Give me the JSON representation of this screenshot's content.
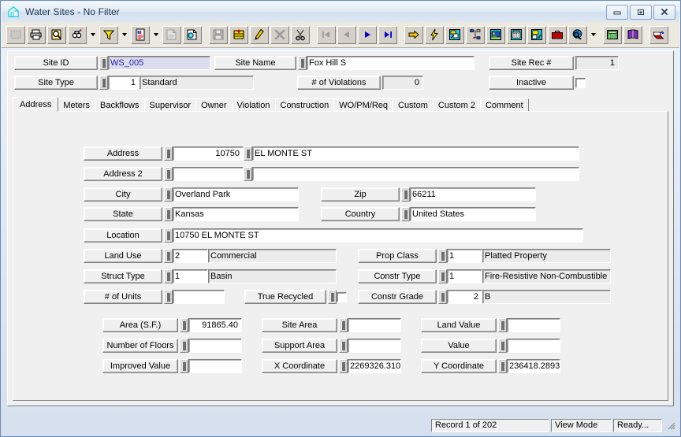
{
  "window": {
    "title": "Water Sites - No Filter",
    "icon": "water-tank-icon",
    "minimize_label": "Minimize",
    "restore_label": "Restore",
    "close_label": "Close"
  },
  "toolbar": {
    "groups": [
      {
        "buttons": [
          {
            "name": "select-all-icon",
            "label": "Select All",
            "disabled": true
          },
          {
            "name": "print-icon",
            "label": "Print"
          },
          {
            "name": "print-preview-icon",
            "label": "Print Preview"
          },
          {
            "name": "find-icon",
            "label": "Find",
            "dropdown": true
          },
          {
            "name": "filter-icon",
            "label": "Filter",
            "dropdown": true
          },
          {
            "name": "report-icon",
            "label": "Reports",
            "dropdown": true
          },
          {
            "name": "copy-record-icon",
            "label": "Copy Record",
            "disabled": true
          },
          {
            "name": "duplicate-icon",
            "label": "Duplicate"
          }
        ]
      },
      {
        "buttons": [
          {
            "name": "save-icon",
            "label": "Save",
            "disabled": true
          },
          {
            "name": "post-icon",
            "label": "Post"
          },
          {
            "name": "edit-pencil-icon",
            "label": "Edit"
          },
          {
            "name": "delete-x-icon",
            "label": "Delete",
            "disabled": true
          },
          {
            "name": "cut-scissors-icon",
            "label": "Cut"
          }
        ]
      },
      {
        "buttons": [
          {
            "name": "first-record-icon",
            "label": "First Record",
            "disabled": true
          },
          {
            "name": "previous-record-icon",
            "label": "Previous Record",
            "disabled": true
          },
          {
            "name": "next-record-icon",
            "label": "Next Record"
          },
          {
            "name": "last-record-icon",
            "label": "Last Record"
          }
        ]
      },
      {
        "buttons": [
          {
            "name": "goto-arrow-icon",
            "label": "Go To"
          },
          {
            "name": "lightning-icon",
            "label": "Quick Action"
          },
          {
            "name": "map-icon",
            "label": "Map"
          },
          {
            "name": "hierarchy-icon",
            "label": "Hierarchy"
          },
          {
            "name": "image-icon",
            "label": "Images"
          },
          {
            "name": "fax-icon",
            "label": "Fax"
          },
          {
            "name": "attachment-image-icon",
            "label": "Attachments"
          },
          {
            "name": "toolbox-icon",
            "label": "Tools"
          },
          {
            "name": "globe-search-icon",
            "label": "Web Lookup",
            "dropdown": true
          }
        ]
      },
      {
        "buttons": [
          {
            "name": "calculator-icon",
            "label": "Calculator"
          },
          {
            "name": "book-icon",
            "label": "Help Book"
          }
        ]
      },
      {
        "buttons": [
          {
            "name": "exit-icon",
            "label": "Exit"
          }
        ]
      }
    ]
  },
  "header": {
    "site_id": {
      "label": "Site ID",
      "value": "WS_005",
      "selected": true
    },
    "site_name": {
      "label": "Site Name",
      "value": "Fox Hill S"
    },
    "site_rec": {
      "label": "Site Rec #",
      "value": "1"
    },
    "site_type": {
      "label": "Site Type",
      "code": "1",
      "desc": "Standard"
    },
    "violations": {
      "label": "# of Violations",
      "value": "0"
    },
    "inactive": {
      "label": "Inactive",
      "checked": false
    }
  },
  "tabs": [
    {
      "label": "Address",
      "active": true
    },
    {
      "label": "Meters",
      "active": false
    },
    {
      "label": "Backflows",
      "active": false
    },
    {
      "label": "Supervisor",
      "active": false
    },
    {
      "label": "Owner",
      "active": false
    },
    {
      "label": "Violation",
      "active": false
    },
    {
      "label": "Construction",
      "active": false
    },
    {
      "label": "WO/PM/Req",
      "active": false
    },
    {
      "label": "Custom",
      "active": false
    },
    {
      "label": "Custom 2",
      "active": false
    },
    {
      "label": "Comment",
      "active": false
    }
  ],
  "address_tab": {
    "address": {
      "label": "Address",
      "number": "10750",
      "street": "EL MONTE ST"
    },
    "address2": {
      "label": "Address 2",
      "number": "",
      "street": ""
    },
    "city": {
      "label": "City",
      "value": "Overland Park"
    },
    "zip": {
      "label": "Zip",
      "value": "66211"
    },
    "state": {
      "label": "State",
      "value": "Kansas"
    },
    "country": {
      "label": "Country",
      "value": "United States"
    },
    "location": {
      "label": "Location",
      "value": "10750 EL MONTE ST"
    },
    "land_use": {
      "label": "Land Use",
      "code": "2",
      "desc": "Commercial"
    },
    "prop_class": {
      "label": "Prop Class",
      "code": "1",
      "desc": "Platted Property"
    },
    "struct_type": {
      "label": "Struct Type",
      "code": "1",
      "desc": "Basin"
    },
    "constr_type": {
      "label": "Constr Type",
      "code": "1",
      "desc": "Fire-Resistive Non-Combustible"
    },
    "units": {
      "label": "# of Units",
      "value": ""
    },
    "true_recycled": {
      "label": "True Recycled",
      "checked": false
    },
    "constr_grade": {
      "label": "Constr Grade",
      "code": "2",
      "desc": "B"
    },
    "area_sf": {
      "label": "Area (S.F.)",
      "value": "91865.40"
    },
    "site_area": {
      "label": "Site Area",
      "value": ""
    },
    "land_value": {
      "label": "Land Value",
      "value": ""
    },
    "floors": {
      "label": "Number of Floors",
      "value": ""
    },
    "support_area": {
      "label": "Support Area",
      "value": ""
    },
    "value": {
      "label": "Value",
      "value": ""
    },
    "improved_value": {
      "label": "Improved Value",
      "value": ""
    },
    "x_coordinate": {
      "label": "X Coordinate",
      "value": "2269326.3100"
    },
    "y_coordinate": {
      "label": "Y Coordinate",
      "value": "236418.2893"
    }
  },
  "statusbar": {
    "record": "Record 1 of 202",
    "mode": "View Mode",
    "state": "Ready...",
    "grip": "resize-grip-icon"
  },
  "colors": {
    "titlebar_text": "#16334d",
    "window_border": "#6a8cb0",
    "face": "#f0f0f0",
    "toolbar": "#ece9e1",
    "selection_bg": "#dcdcf0",
    "selection_fg": "#2222aa"
  }
}
